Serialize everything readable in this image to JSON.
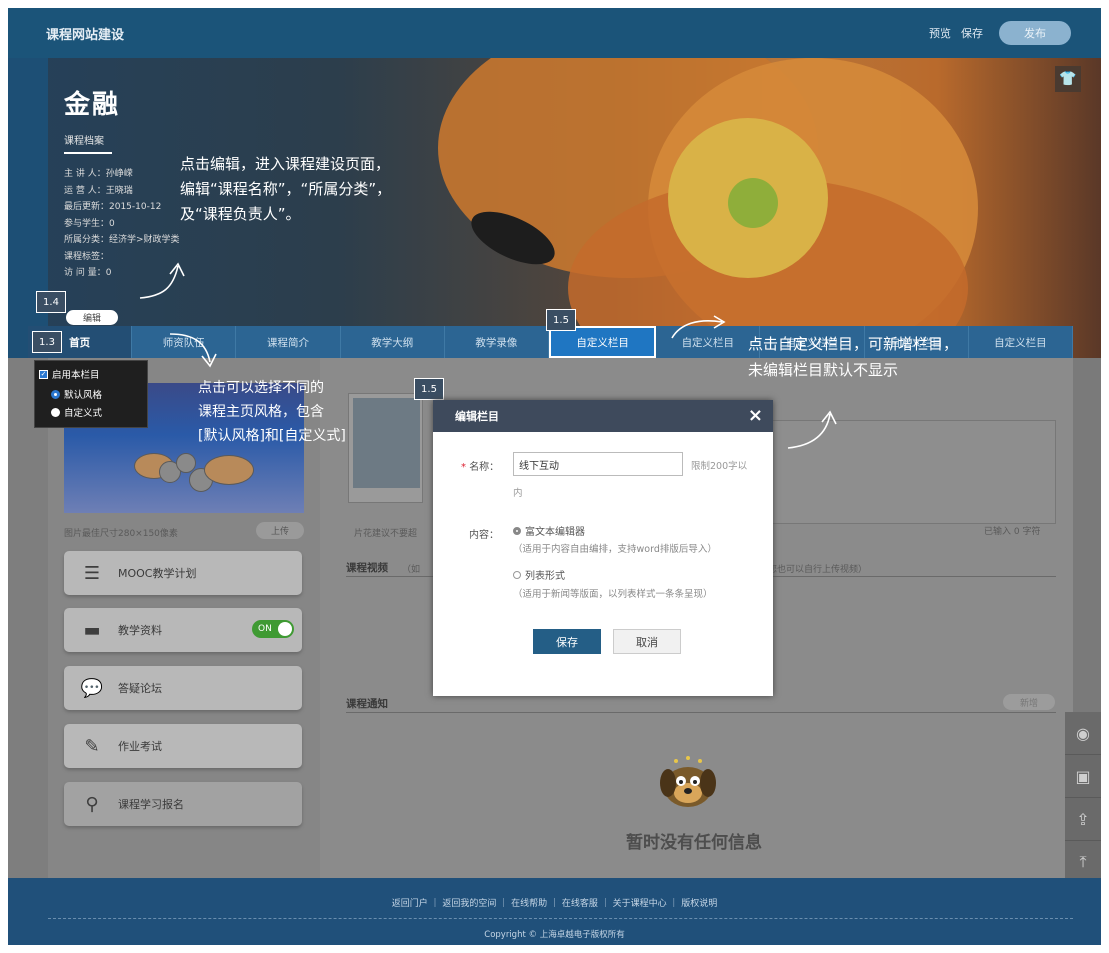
{
  "header": {
    "site_title": "课程网站建设",
    "preview": "预览",
    "save": "保存",
    "publish": "发布"
  },
  "banner": {
    "course_name": "金融",
    "archive_label": "课程档案",
    "meta": [
      "主 讲 人：孙峥嵘",
      "运 营 人：王晓瑞",
      "最后更新：2015-10-12",
      "参与学生：0",
      "所属分类：经济学>财政学类",
      "课程标签：",
      "访 问 量：0"
    ],
    "edit_button": "编辑"
  },
  "badges": {
    "b14": "1.4",
    "b13": "1.3",
    "b15_nav": "1.5",
    "b15_modal": "1.5"
  },
  "annotations": {
    "banner_note": [
      "点击编辑，进入课程建设页面，",
      "编辑“课程名称”，“所属分类”，",
      "及“课程负责人”。"
    ],
    "style_note": [
      "点击可以选择不同的",
      "课程主页风格，包含",
      "[默认风格]和[自定义式]"
    ],
    "custom_note": [
      "点击自定义栏目，可新增栏目，",
      "未编辑栏目默认不显示"
    ]
  },
  "nav": {
    "items": [
      "首页",
      "师资队伍",
      "课程简介",
      "教学大纲",
      "教学录像",
      "自定义栏目",
      "自定义栏目",
      "自定义栏目",
      "自定义栏目",
      "自定义栏目"
    ]
  },
  "home_dropdown": {
    "enable": "启用本栏目",
    "default_style": "默认风格",
    "custom_style": "自定义式"
  },
  "left_panel": {
    "image_hint": "图片最佳尺寸280×150像素",
    "upload": "上传",
    "menu": [
      {
        "label": "MOOC教学计划",
        "icon": "list-icon"
      },
      {
        "label": "教学资料",
        "icon": "folder-icon"
      },
      {
        "label": "答疑论坛",
        "icon": "chat-icon"
      },
      {
        "label": "作业考试",
        "icon": "edit-icon"
      },
      {
        "label": "课程学习报名",
        "icon": "location-icon"
      }
    ],
    "toggle_on": "ON"
  },
  "right_panel": {
    "thumb_hint": "片花建议不要超",
    "char_count": "已输入 0 字符",
    "video_title": "课程视频",
    "video_hint_left": "（如",
    "video_hint_right": "您也可以自行上传视频）",
    "notice_title": "课程通知",
    "new_button": "新增",
    "empty_message": "暂时没有任何信息"
  },
  "modal": {
    "title": "编辑栏目",
    "close": "×",
    "name_required": "*",
    "name_label": "名称：",
    "name_value": "线下互动",
    "name_limit_1": "限制200字以",
    "name_limit_2": "内",
    "content_label": "内容：",
    "option_rich": "富文本编辑器",
    "option_rich_sub": "（适用于内容自由编排，支持word排版后导入）",
    "option_list": "列表形式",
    "option_list_sub": "（适用于新闻等版面，以列表样式一条条呈现）",
    "save": "保存",
    "cancel": "取消"
  },
  "footer": {
    "links": "返回门户 ｜ 返回我的空间 ｜ 在线帮助 ｜ 在线客服 ｜ 关于课程中心 ｜ 版权说明",
    "copyright": "Copyright © 上海卓越电子版权所有"
  },
  "colors": {
    "header_bg": "#1b5479",
    "nav_bg": "#2c6593",
    "nav_active": "#1f76c2",
    "footer_bg": "#20507a",
    "modal_head": "#3e4a5c",
    "save_btn": "#245e86",
    "toggle_on": "#3f9a33"
  }
}
